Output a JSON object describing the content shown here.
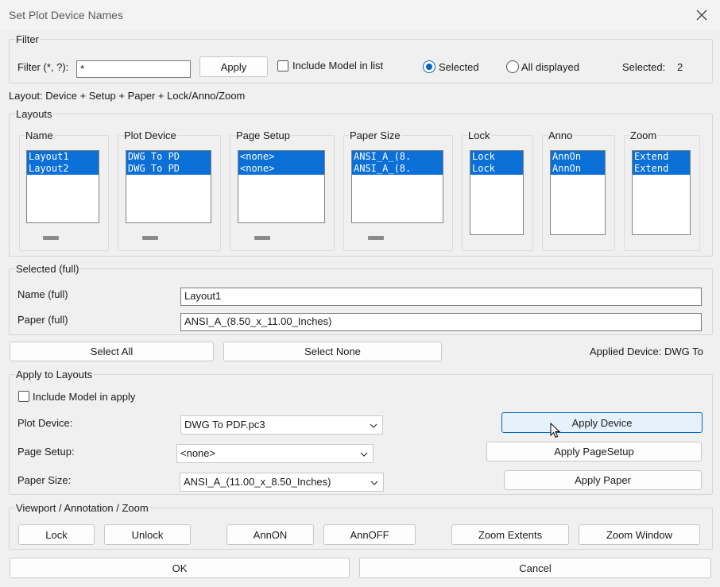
{
  "window": {
    "title": "Set Plot Device Names"
  },
  "filter": {
    "group_label": "Filter",
    "label": "Filter (*, ?):",
    "value": "*",
    "apply_label": "Apply",
    "include_model_label": "Include Model in list",
    "include_model_checked": false,
    "radio_selected_label": "Selected",
    "radio_all_label": "All displayed",
    "radio_value": "Selected",
    "selected_count_label": "Selected:",
    "selected_count": "2"
  },
  "layout_caption": "Layout: Device + Setup + Paper + Lock/Anno/Zoom",
  "layouts": {
    "group_label": "Layouts",
    "columns": [
      {
        "header": "Name",
        "items": [
          "Layout1",
          "Layout2"
        ]
      },
      {
        "header": "Plot Device",
        "items": [
          "DWG To PD",
          "DWG To PD"
        ]
      },
      {
        "header": "Page Setup",
        "items": [
          "<none>",
          "<none>"
        ]
      },
      {
        "header": "Paper Size",
        "items": [
          "ANSI_A_(8.",
          "ANSI_A_(8."
        ]
      },
      {
        "header": "Lock",
        "items": [
          "Lock",
          "Lock"
        ]
      },
      {
        "header": "Anno",
        "items": [
          "AnnOn",
          "AnnOn"
        ]
      },
      {
        "header": "Zoom",
        "items": [
          "Extend",
          "Extend"
        ]
      }
    ]
  },
  "selected_full": {
    "group_label": "Selected (full)",
    "name_label": "Name (full)",
    "name_value": "Layout1",
    "paper_label": "Paper (full)",
    "paper_value": "ANSI_A_(8.50_x_11.00_Inches)"
  },
  "selection": {
    "select_all_label": "Select All",
    "select_none_label": "Select None",
    "applied_device_text": "Applied Device: DWG To"
  },
  "apply": {
    "group_label": "Apply to Layouts",
    "include_model_label": "Include Model in apply",
    "include_model_checked": false,
    "plot_device_label": "Plot Device:",
    "plot_device_value": "DWG To PDF.pc3",
    "page_setup_label": "Page Setup:",
    "page_setup_value": "<none>",
    "paper_size_label": "Paper Size:",
    "paper_size_value": "ANSI_A_(11.00_x_8.50_Inches)",
    "apply_device_label": "Apply Device",
    "apply_pagesetup_label": "Apply PageSetup",
    "apply_paper_label": "Apply Paper"
  },
  "viewport": {
    "group_label": "Viewport / Annotation / Zoom",
    "lock_label": "Lock",
    "unlock_label": "Unlock",
    "annon_label": "AnnON",
    "annoff_label": "AnnOFF",
    "zoom_extents_label": "Zoom Extents",
    "zoom_window_label": "Zoom Window"
  },
  "footer": {
    "ok_label": "OK",
    "cancel_label": "Cancel"
  },
  "colors": {
    "selection": "#0a6fd6",
    "accent": "#0067c0",
    "background": "#f0f0f0"
  }
}
